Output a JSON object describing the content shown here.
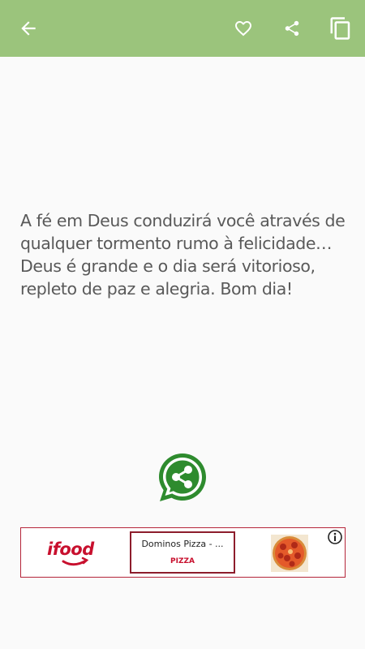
{
  "toolbar": {
    "background": "#9bc47c",
    "icons": [
      "back-arrow-icon",
      "heart-icon",
      "share-icon",
      "copy-icon"
    ]
  },
  "quote": {
    "text": "A fé em Deus conduzirá você através de qualquer tormento rumo à felicidade… Deus é grande e o dia será vitorioso, repleto de paz e alegria. Bom dia!"
  },
  "whatsapp_share": {
    "icon": "whatsapp-share-icon",
    "color": "#2e8b2e"
  },
  "ad": {
    "brand": "ifood",
    "title": "Dominos Pizza - ...",
    "subtitle": "PIZZA",
    "brand_color": "#c8102e",
    "info_icon": "info-icon"
  }
}
